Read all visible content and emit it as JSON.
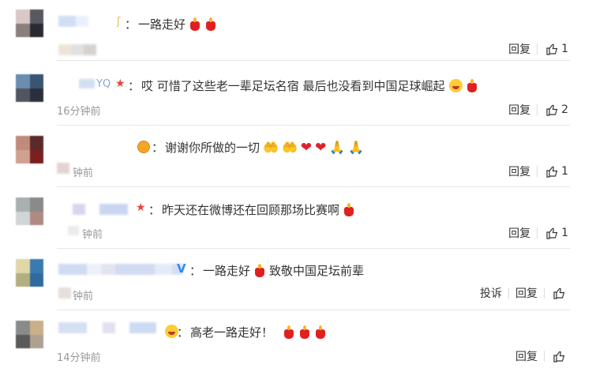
{
  "comments": [
    {
      "name_tail": "ʃ",
      "text": "一路走好",
      "time": "",
      "actions": {
        "reply": "回复",
        "likes": "1"
      }
    },
    {
      "name_tail": "YQ",
      "text": "哎 可惜了这些老一辈足坛名宿 最后也没看到中国足球崛起",
      "time": "16分钟前",
      "actions": {
        "reply": "回复",
        "likes": "2"
      }
    },
    {
      "name_tail": "",
      "text": "谢谢你所做的一切",
      "time": "钟前",
      "actions": {
        "reply": "回复",
        "likes": "1"
      }
    },
    {
      "name_tail": "",
      "text": "昨天还在微博还在回顾那场比赛啊",
      "time": "钟前",
      "actions": {
        "reply": "回复",
        "likes": "1"
      }
    },
    {
      "name_tail": "V",
      "text": "一路走好",
      "text2": "致敬中国足坛前辈",
      "time": "钟前",
      "actions": {
        "report": "投诉",
        "reply": "回复",
        "likes": ""
      }
    },
    {
      "name_tail": "",
      "text": "高老一路走好！",
      "time": "14分钟前",
      "actions": {
        "reply": "回复",
        "likes": ""
      }
    }
  ],
  "colors": {
    "divider": "#e6e6e6",
    "time": "#999999",
    "star": "#e8443a",
    "vip": "#2f8cf5"
  },
  "icons": [
    "like-thumb-icon",
    "candle-emoji",
    "heart-emoji",
    "pray-emoji",
    "face-emoji",
    "star-icon"
  ]
}
